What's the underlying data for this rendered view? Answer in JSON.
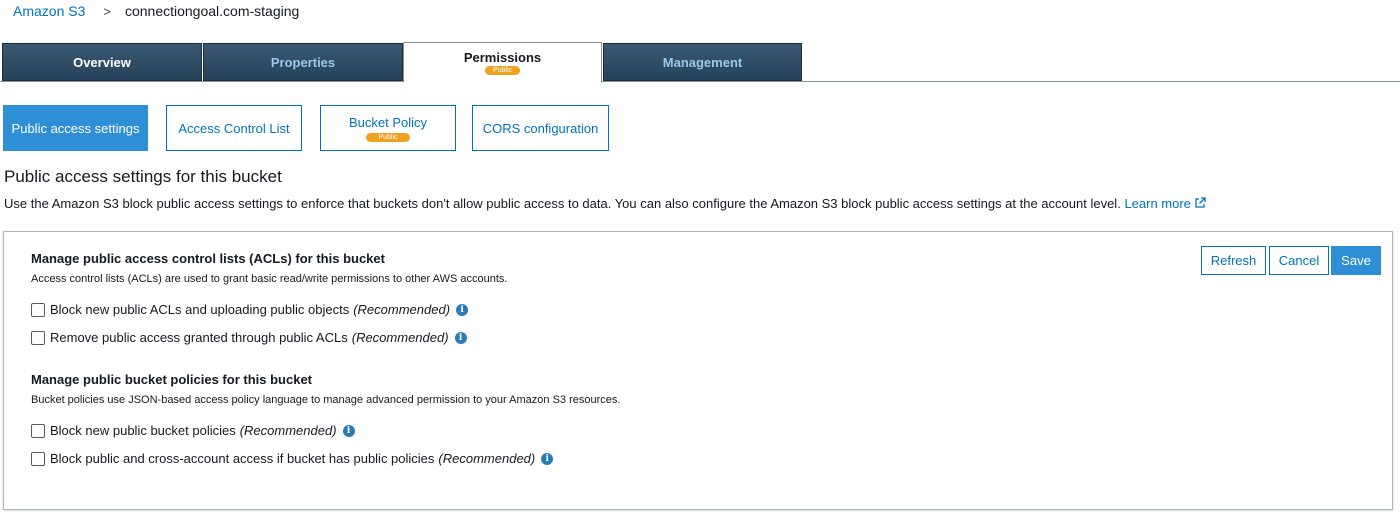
{
  "breadcrumb": {
    "root": "Amazon S3",
    "separator": ">",
    "current": "connectiongoal.com-staging"
  },
  "tabs": [
    {
      "label": "Overview",
      "active": false
    },
    {
      "label": "Properties",
      "active": false
    },
    {
      "label": "Permissions",
      "active": true,
      "badge": "Public"
    },
    {
      "label": "Management",
      "active": false
    }
  ],
  "subtabs": [
    {
      "label": "Public access settings",
      "selected": true
    },
    {
      "label": "Access Control List",
      "selected": false
    },
    {
      "label": "Bucket Policy",
      "selected": false,
      "badge": "Public"
    },
    {
      "label": "CORS configuration",
      "selected": false
    }
  ],
  "section": {
    "title": "Public access settings for this bucket",
    "description": "Use the Amazon S3 block public access settings to enforce that buckets don't allow public access to data. You can also configure the Amazon S3 block public access settings at the account level.",
    "learn_more": "Learn more"
  },
  "buttons": {
    "refresh": "Refresh",
    "cancel": "Cancel",
    "save": "Save"
  },
  "acl_group": {
    "title": "Manage public access control lists (ACLs) for this bucket",
    "description": "Access control lists (ACLs) are used to grant basic read/write permissions to other AWS accounts.",
    "options": [
      {
        "label": "Block new public ACLs and uploading public objects",
        "note": "(Recommended)",
        "checked": false
      },
      {
        "label": "Remove public access granted through public ACLs",
        "note": "(Recommended)",
        "checked": false
      }
    ]
  },
  "policy_group": {
    "title": "Manage public bucket policies for this bucket",
    "description": "Bucket policies use JSON-based access policy language to manage advanced permission to your Amazon S3 resources.",
    "options": [
      {
        "label": "Block new public bucket policies",
        "note": "(Recommended)",
        "checked": false
      },
      {
        "label": "Block public and cross-account access if bucket has public policies",
        "note": "(Recommended)",
        "checked": false
      }
    ]
  },
  "colors": {
    "link": "#0073bb",
    "primary": "#2e8fd6",
    "badge": "#f0a122",
    "tab_dark": "#2e4a62"
  },
  "icons": {
    "info": "info-icon",
    "external_link": "external-link-icon"
  }
}
